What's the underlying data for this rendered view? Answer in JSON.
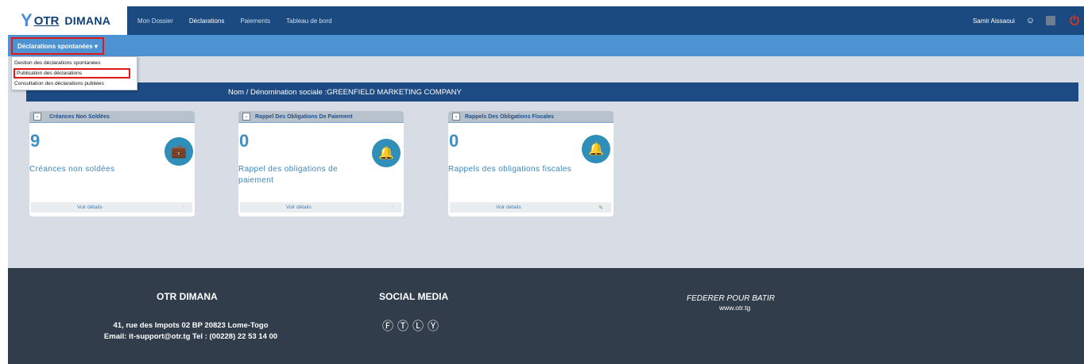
{
  "app": {
    "logo_y": "Y",
    "logo_otr": "OTR",
    "logo_name": "DIMANA"
  },
  "nav": {
    "items": [
      {
        "label": "Mon Dossier"
      },
      {
        "label": "Déclarations"
      },
      {
        "label": "Paiements"
      },
      {
        "label": "Tableau de bord"
      }
    ]
  },
  "user": {
    "name": "Samir Aissaoui"
  },
  "subnav": {
    "dropdown_label": "Déclarations spontanées ▾",
    "menu": [
      {
        "label": "Gestion des déclarations spontanées"
      },
      {
        "label": "Publication des déclarations"
      },
      {
        "label": "Consultation des déclarations publiées"
      }
    ]
  },
  "banner": {
    "text": "Nom / Dénomination sociale :GREENFIELD MARKETING COMPANY"
  },
  "cards": [
    {
      "title": "Créances Non Soldées",
      "count": "9",
      "description": "Créances non soldées",
      "footer": "Voir détails",
      "icon": "wallet-icon"
    },
    {
      "title": "Rappel Des Obligations De Paiement",
      "count": "0",
      "description": "Rappel des obligations de paiement",
      "footer": "Voir détails",
      "icon": "bell-clock-icon"
    },
    {
      "title": "Rappels Des Obligations Fiscales",
      "count": "0",
      "description": "Rappels des obligations fiscales",
      "footer": "Voir détails",
      "icon": "bell-clock-icon"
    }
  ],
  "footer": {
    "org_title": "OTR DIMANA",
    "address": "41, rue des Impots 02 BP 20823 Lome-Togo Email: it-support@otr.tg Tel : (00228) 22 53 14 00",
    "social_title": "SOCIAL MEDIA",
    "motto": "FEDERER POUR BATIR",
    "url": "www.otr.tg"
  },
  "colors": {
    "topbar": "#1b4a80",
    "subbar": "#4d93d1",
    "accent_red": "#e01818",
    "footer": "#323d4b",
    "count_blue": "#3d8fc6"
  }
}
